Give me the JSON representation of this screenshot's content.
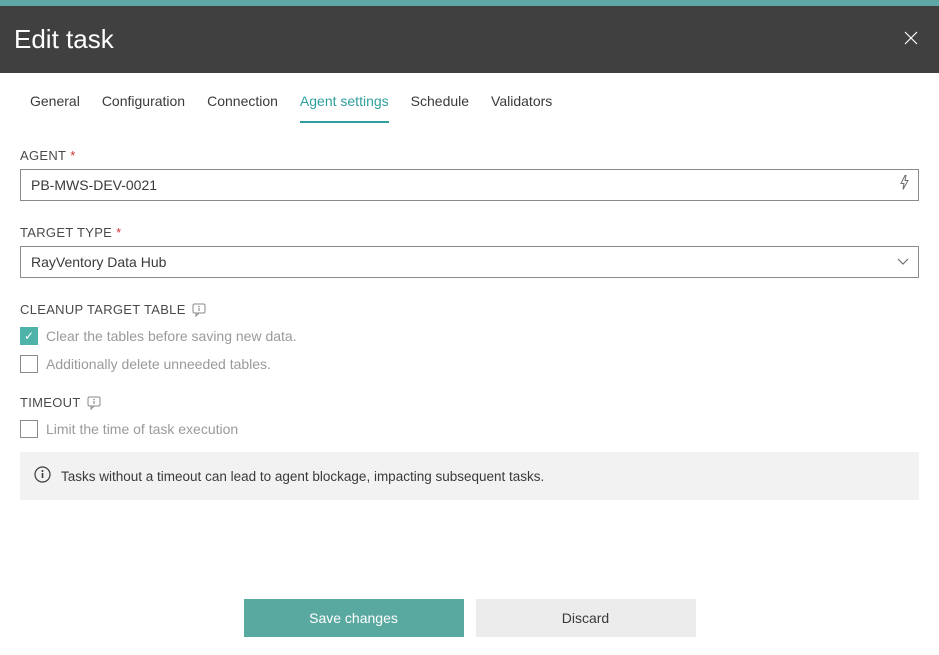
{
  "header": {
    "title": "Edit task"
  },
  "tabs": {
    "items": [
      {
        "label": "General"
      },
      {
        "label": "Configuration"
      },
      {
        "label": "Connection"
      },
      {
        "label": "Agent settings"
      },
      {
        "label": "Schedule"
      },
      {
        "label": "Validators"
      }
    ],
    "active_index": 3
  },
  "form": {
    "agent": {
      "label": "AGENT",
      "value": "PB-MWS-DEV-0021"
    },
    "target_type": {
      "label": "TARGET TYPE",
      "value": "RayVentory Data Hub"
    },
    "cleanup": {
      "label": "CLEANUP TARGET TABLE",
      "clear_tables": {
        "label": "Clear the tables before saving new data.",
        "checked": true
      },
      "delete_unneeded": {
        "label": "Additionally delete unneeded tables.",
        "checked": false
      }
    },
    "timeout": {
      "label": "TIMEOUT",
      "limit_time": {
        "label": "Limit the time of task execution",
        "checked": false
      },
      "info": "Tasks without a timeout can lead to agent blockage, impacting subsequent tasks."
    }
  },
  "footer": {
    "save": "Save changes",
    "discard": "Discard"
  }
}
